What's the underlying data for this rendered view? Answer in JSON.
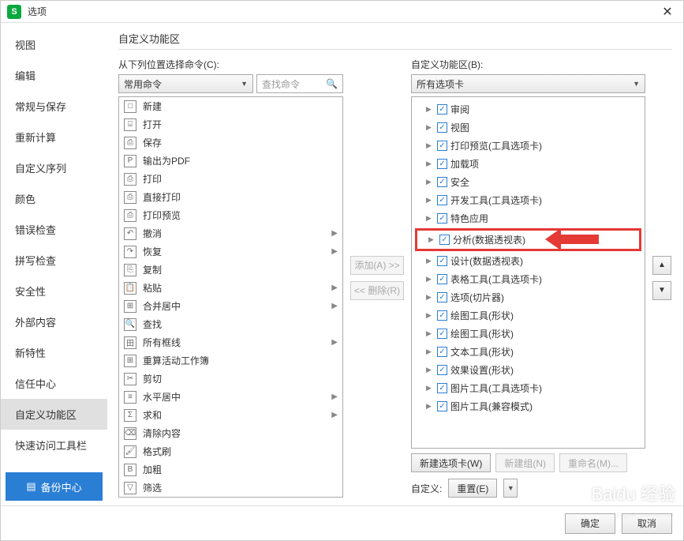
{
  "window": {
    "title": "选项",
    "close": "✕"
  },
  "sidebar": {
    "items": [
      "视图",
      "编辑",
      "常规与保存",
      "重新计算",
      "自定义序列",
      "颜色",
      "错误检查",
      "拼写检查",
      "安全性",
      "外部内容",
      "新特性",
      "信任中心",
      "自定义功能区",
      "快速访问工具栏"
    ],
    "selected_index": 12,
    "backup": "备份中心"
  },
  "content": {
    "section_title": "自定义功能区",
    "left_label": "从下列位置选择命令(C):",
    "left_dropdown": "常用命令",
    "search_placeholder": "查找命令",
    "right_label": "自定义功能区(B):",
    "right_dropdown": "所有选项卡",
    "add_btn": "添加(A) >>",
    "remove_btn": "<< 删除(R)",
    "new_tab": "新建选项卡(W)",
    "new_group": "新建组(N)",
    "rename": "重命名(M)...",
    "custom_label": "自定义:",
    "reset": "重置(E)"
  },
  "commands": [
    {
      "icon": "□",
      "label": "新建"
    },
    {
      "icon": "⌸",
      "label": "打开"
    },
    {
      "icon": "⎙",
      "label": "保存"
    },
    {
      "icon": "P",
      "label": "输出为PDF"
    },
    {
      "icon": "⎙",
      "label": "打印"
    },
    {
      "icon": "⎙",
      "label": "直接打印"
    },
    {
      "icon": "⎙",
      "label": "打印预览"
    },
    {
      "icon": "↶",
      "label": "撤消",
      "sub": true
    },
    {
      "icon": "↷",
      "label": "恢复",
      "sub": true
    },
    {
      "icon": "⎘",
      "label": "复制"
    },
    {
      "icon": "📋",
      "label": "粘贴",
      "sub": true
    },
    {
      "icon": "⊞",
      "label": "合并居中",
      "sub": true
    },
    {
      "icon": "🔍",
      "label": "查找"
    },
    {
      "icon": "田",
      "label": "所有框线",
      "sub": true
    },
    {
      "icon": "⊞",
      "label": "重算活动工作簿"
    },
    {
      "icon": "✂",
      "label": "剪切"
    },
    {
      "icon": "≡",
      "label": "水平居中",
      "sub": true
    },
    {
      "icon": "Σ",
      "label": "求和",
      "sub": true
    },
    {
      "icon": "⌫",
      "label": "清除内容"
    },
    {
      "icon": "🖌",
      "label": "格式刷"
    },
    {
      "icon": "B",
      "label": "加粗"
    },
    {
      "icon": "▽",
      "label": "筛选"
    }
  ],
  "tree": [
    {
      "label": "审阅",
      "indent": 1
    },
    {
      "label": "视图",
      "indent": 1
    },
    {
      "label": "打印预览(工具选项卡)",
      "indent": 1
    },
    {
      "label": "加载项",
      "indent": 1
    },
    {
      "label": "安全",
      "indent": 1
    },
    {
      "label": "开发工具(工具选项卡)",
      "indent": 1
    },
    {
      "label": "特色应用",
      "indent": 1
    },
    {
      "label": "分析(数据透视表)",
      "indent": 1,
      "highlight": true
    },
    {
      "label": "设计(数据透视表)",
      "indent": 1
    },
    {
      "label": "表格工具(工具选项卡)",
      "indent": 1
    },
    {
      "label": "选项(切片器)",
      "indent": 1
    },
    {
      "label": "绘图工具(形状)",
      "indent": 1
    },
    {
      "label": "绘图工具(形状)",
      "indent": 1
    },
    {
      "label": "文本工具(形状)",
      "indent": 1
    },
    {
      "label": "效果设置(形状)",
      "indent": 1
    },
    {
      "label": "图片工具(工具选项卡)",
      "indent": 1
    },
    {
      "label": "图片工具(兼容模式)",
      "indent": 1
    }
  ],
  "footer": {
    "ok": "确定",
    "cancel": "取消"
  }
}
